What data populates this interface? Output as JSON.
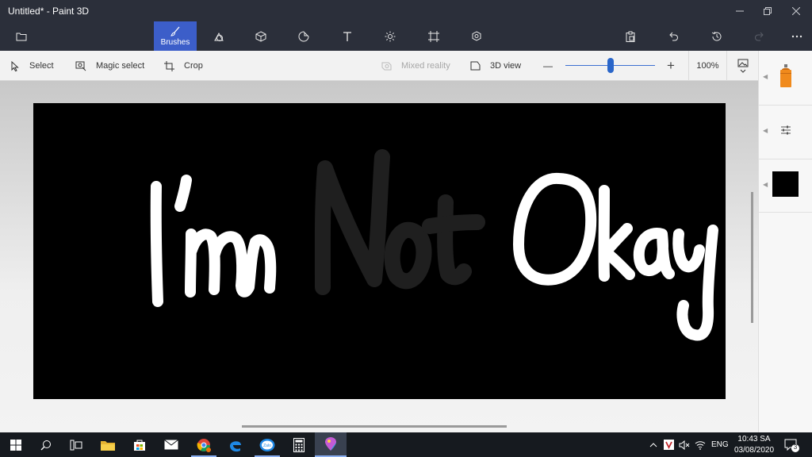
{
  "window": {
    "title": "Untitled* - Paint 3D",
    "controls": [
      "minimize",
      "maximize",
      "close"
    ]
  },
  "ribbon": {
    "open_menu_icon": "folder-icon",
    "active_tab_label": "Brushes",
    "tools": [
      "2d-shapes",
      "3d-shapes",
      "stickers",
      "text",
      "effects",
      "canvas",
      "3d-library"
    ],
    "actions": [
      "paste",
      "undo",
      "history",
      "redo",
      "more"
    ]
  },
  "toolbar": {
    "select_label": "Select",
    "magic_select_label": "Magic select",
    "crop_label": "Crop",
    "mixed_reality_label": "Mixed reality",
    "view_3d_label": "3D view",
    "zoom_out_symbol": "—",
    "zoom_in_symbol": "+",
    "zoom_value": "100%",
    "zoom_fraction": 0.5
  },
  "canvas": {
    "handwriting_words": [
      "I'm",
      "Not",
      "Okay"
    ],
    "background_color": "#000000",
    "stroke_color": "#ffffff"
  },
  "side_panel": {
    "current_tool_icon": "spray-can-icon",
    "settings_icon": "sliders-icon",
    "current_color": "#000000"
  },
  "taskbar": {
    "apps": [
      "start",
      "search",
      "task-view",
      "file-explorer",
      "store",
      "mail",
      "chrome",
      "edge",
      "zalo",
      "calculator",
      "paint-3d"
    ],
    "language": "ENG",
    "time": "10:43 SA",
    "date": "03/08/2020",
    "notification_count": "3"
  },
  "colors": {
    "titlebar_bg": "#2b2f3a",
    "accent": "#3c5ec9",
    "taskbar_bg": "#161a1f",
    "spray_orange": "#f08a1c"
  }
}
